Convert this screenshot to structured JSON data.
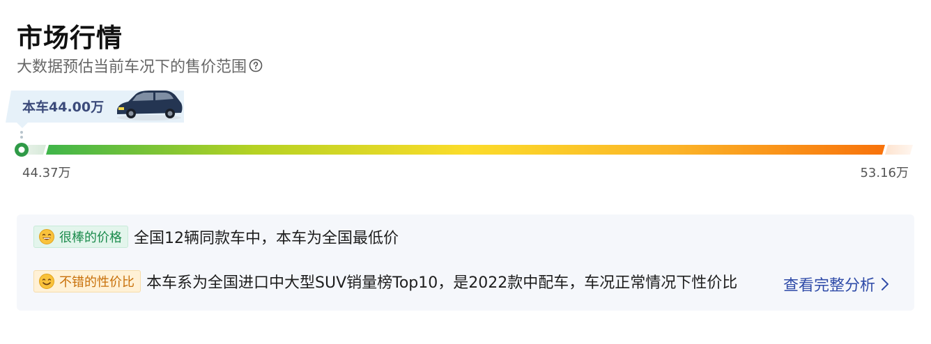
{
  "header": {
    "title": "市场行情",
    "subtitle": "大数据预估当前车况下的售价范围",
    "help_icon": "question-circle-icon"
  },
  "current_price_tag": {
    "label": "本车44.00万",
    "image": "car-thumbnail"
  },
  "price_range": {
    "min_label": "44.37万",
    "max_label": "53.16万",
    "colors": [
      "#3fb54a",
      "#b6d223",
      "#fbdc2a",
      "#fbb428",
      "#f8720b"
    ]
  },
  "analysis": {
    "items": [
      {
        "badge_label": "很棒的价格",
        "badge_icon": "grin-emoji-icon",
        "text": "全国12辆同款车中，本车为全国最低价"
      },
      {
        "badge_label": "不错的性价比",
        "badge_icon": "smile-emoji-icon",
        "text": "本车系为全国进口中大型SUV销量榜Top10，是2022款中配车，车况正常情况下性价比"
      }
    ],
    "link_label": "查看完整分析",
    "link_icon": "chevron-right-icon"
  }
}
